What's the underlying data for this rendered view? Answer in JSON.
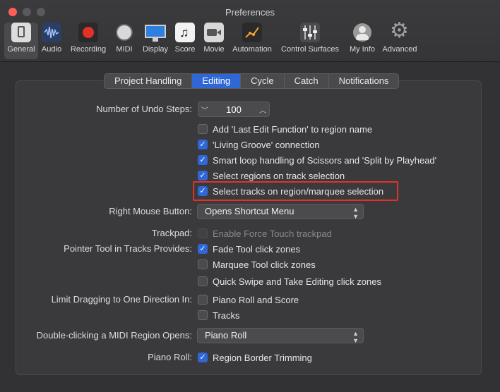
{
  "window": {
    "title": "Preferences"
  },
  "toolbar": [
    {
      "label": "General",
      "icon": "general-icon",
      "selected": true
    },
    {
      "label": "Audio",
      "icon": "audio-waveform-icon"
    },
    {
      "label": "Recording",
      "icon": "record-icon"
    },
    {
      "label": "MIDI",
      "icon": "midi-connector-icon"
    },
    {
      "label": "Display",
      "icon": "display-icon"
    },
    {
      "label": "Score",
      "icon": "score-icon"
    },
    {
      "label": "Movie",
      "icon": "movie-camera-icon"
    },
    {
      "label": "Automation",
      "icon": "automation-icon"
    },
    {
      "label": "Control Surfaces",
      "icon": "control-surfaces-icon"
    },
    {
      "label": "My Info",
      "icon": "user-icon"
    },
    {
      "label": "Advanced",
      "icon": "gear-icon"
    }
  ],
  "tabs": [
    {
      "label": "Project Handling"
    },
    {
      "label": "Editing",
      "active": true
    },
    {
      "label": "Cycle"
    },
    {
      "label": "Catch"
    },
    {
      "label": "Notifications"
    }
  ],
  "editing": {
    "undo_label": "Number of Undo Steps:",
    "undo_value": "100",
    "checks_top": [
      {
        "label": "Add 'Last Edit Function' to region name",
        "checked": false
      },
      {
        "label": "'Living Groove' connection",
        "checked": true
      },
      {
        "label": "Smart loop handling of Scissors and 'Split by Playhead'",
        "checked": true
      },
      {
        "label": "Select regions on track selection",
        "checked": true
      },
      {
        "label": "Select tracks on region/marquee selection",
        "checked": true
      }
    ],
    "right_mouse_label": "Right Mouse Button:",
    "right_mouse_value": "Opens Shortcut Menu",
    "trackpad_label": "Trackpad:",
    "trackpad_check": {
      "label": "Enable Force Touch trackpad",
      "checked": false
    },
    "pointer_label": "Pointer Tool in Tracks Provides:",
    "pointer_checks": [
      {
        "label": "Fade Tool click zones",
        "checked": true
      },
      {
        "label": "Marquee Tool click zones",
        "checked": false
      },
      {
        "label": "Quick Swipe and Take Editing click zones",
        "checked": false
      }
    ],
    "limit_label": "Limit Dragging to One Direction In:",
    "limit_checks": [
      {
        "label": "Piano Roll and Score",
        "checked": false
      },
      {
        "label": "Tracks",
        "checked": false
      }
    ],
    "dblclick_label": "Double-clicking a MIDI Region Opens:",
    "dblclick_value": "Piano Roll",
    "pianoroll_label": "Piano Roll:",
    "pianoroll_check": {
      "label": "Region Border Trimming",
      "checked": true
    }
  },
  "colors": {
    "accent": "#2f67d6",
    "highlight": "#e0322b"
  }
}
